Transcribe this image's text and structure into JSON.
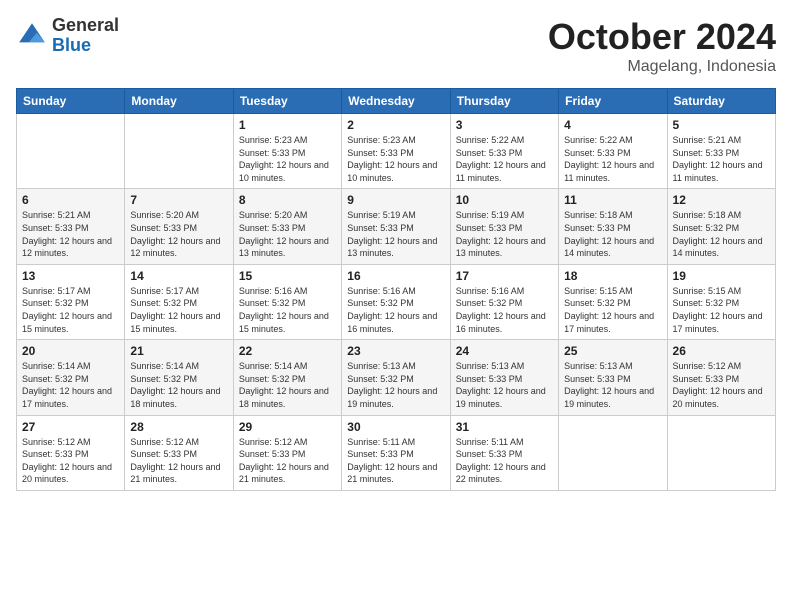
{
  "header": {
    "logo": {
      "general": "General",
      "blue": "Blue"
    },
    "title": "October 2024",
    "location": "Magelang, Indonesia"
  },
  "weekdays": [
    "Sunday",
    "Monday",
    "Tuesday",
    "Wednesday",
    "Thursday",
    "Friday",
    "Saturday"
  ],
  "weeks": [
    [
      null,
      null,
      {
        "day": 1,
        "sunrise": "5:23 AM",
        "sunset": "5:33 PM",
        "daylight": "12 hours and 10 minutes."
      },
      {
        "day": 2,
        "sunrise": "5:23 AM",
        "sunset": "5:33 PM",
        "daylight": "12 hours and 10 minutes."
      },
      {
        "day": 3,
        "sunrise": "5:22 AM",
        "sunset": "5:33 PM",
        "daylight": "12 hours and 11 minutes."
      },
      {
        "day": 4,
        "sunrise": "5:22 AM",
        "sunset": "5:33 PM",
        "daylight": "12 hours and 11 minutes."
      },
      {
        "day": 5,
        "sunrise": "5:21 AM",
        "sunset": "5:33 PM",
        "daylight": "12 hours and 11 minutes."
      }
    ],
    [
      {
        "day": 6,
        "sunrise": "5:21 AM",
        "sunset": "5:33 PM",
        "daylight": "12 hours and 12 minutes."
      },
      {
        "day": 7,
        "sunrise": "5:20 AM",
        "sunset": "5:33 PM",
        "daylight": "12 hours and 12 minutes."
      },
      {
        "day": 8,
        "sunrise": "5:20 AM",
        "sunset": "5:33 PM",
        "daylight": "12 hours and 13 minutes."
      },
      {
        "day": 9,
        "sunrise": "5:19 AM",
        "sunset": "5:33 PM",
        "daylight": "12 hours and 13 minutes."
      },
      {
        "day": 10,
        "sunrise": "5:19 AM",
        "sunset": "5:33 PM",
        "daylight": "12 hours and 13 minutes."
      },
      {
        "day": 11,
        "sunrise": "5:18 AM",
        "sunset": "5:33 PM",
        "daylight": "12 hours and 14 minutes."
      },
      {
        "day": 12,
        "sunrise": "5:18 AM",
        "sunset": "5:32 PM",
        "daylight": "12 hours and 14 minutes."
      }
    ],
    [
      {
        "day": 13,
        "sunrise": "5:17 AM",
        "sunset": "5:32 PM",
        "daylight": "12 hours and 15 minutes."
      },
      {
        "day": 14,
        "sunrise": "5:17 AM",
        "sunset": "5:32 PM",
        "daylight": "12 hours and 15 minutes."
      },
      {
        "day": 15,
        "sunrise": "5:16 AM",
        "sunset": "5:32 PM",
        "daylight": "12 hours and 15 minutes."
      },
      {
        "day": 16,
        "sunrise": "5:16 AM",
        "sunset": "5:32 PM",
        "daylight": "12 hours and 16 minutes."
      },
      {
        "day": 17,
        "sunrise": "5:16 AM",
        "sunset": "5:32 PM",
        "daylight": "12 hours and 16 minutes."
      },
      {
        "day": 18,
        "sunrise": "5:15 AM",
        "sunset": "5:32 PM",
        "daylight": "12 hours and 17 minutes."
      },
      {
        "day": 19,
        "sunrise": "5:15 AM",
        "sunset": "5:32 PM",
        "daylight": "12 hours and 17 minutes."
      }
    ],
    [
      {
        "day": 20,
        "sunrise": "5:14 AM",
        "sunset": "5:32 PM",
        "daylight": "12 hours and 17 minutes."
      },
      {
        "day": 21,
        "sunrise": "5:14 AM",
        "sunset": "5:32 PM",
        "daylight": "12 hours and 18 minutes."
      },
      {
        "day": 22,
        "sunrise": "5:14 AM",
        "sunset": "5:32 PM",
        "daylight": "12 hours and 18 minutes."
      },
      {
        "day": 23,
        "sunrise": "5:13 AM",
        "sunset": "5:32 PM",
        "daylight": "12 hours and 19 minutes."
      },
      {
        "day": 24,
        "sunrise": "5:13 AM",
        "sunset": "5:33 PM",
        "daylight": "12 hours and 19 minutes."
      },
      {
        "day": 25,
        "sunrise": "5:13 AM",
        "sunset": "5:33 PM",
        "daylight": "12 hours and 19 minutes."
      },
      {
        "day": 26,
        "sunrise": "5:12 AM",
        "sunset": "5:33 PM",
        "daylight": "12 hours and 20 minutes."
      }
    ],
    [
      {
        "day": 27,
        "sunrise": "5:12 AM",
        "sunset": "5:33 PM",
        "daylight": "12 hours and 20 minutes."
      },
      {
        "day": 28,
        "sunrise": "5:12 AM",
        "sunset": "5:33 PM",
        "daylight": "12 hours and 21 minutes."
      },
      {
        "day": 29,
        "sunrise": "5:12 AM",
        "sunset": "5:33 PM",
        "daylight": "12 hours and 21 minutes."
      },
      {
        "day": 30,
        "sunrise": "5:11 AM",
        "sunset": "5:33 PM",
        "daylight": "12 hours and 21 minutes."
      },
      {
        "day": 31,
        "sunrise": "5:11 AM",
        "sunset": "5:33 PM",
        "daylight": "12 hours and 22 minutes."
      },
      null,
      null
    ]
  ]
}
